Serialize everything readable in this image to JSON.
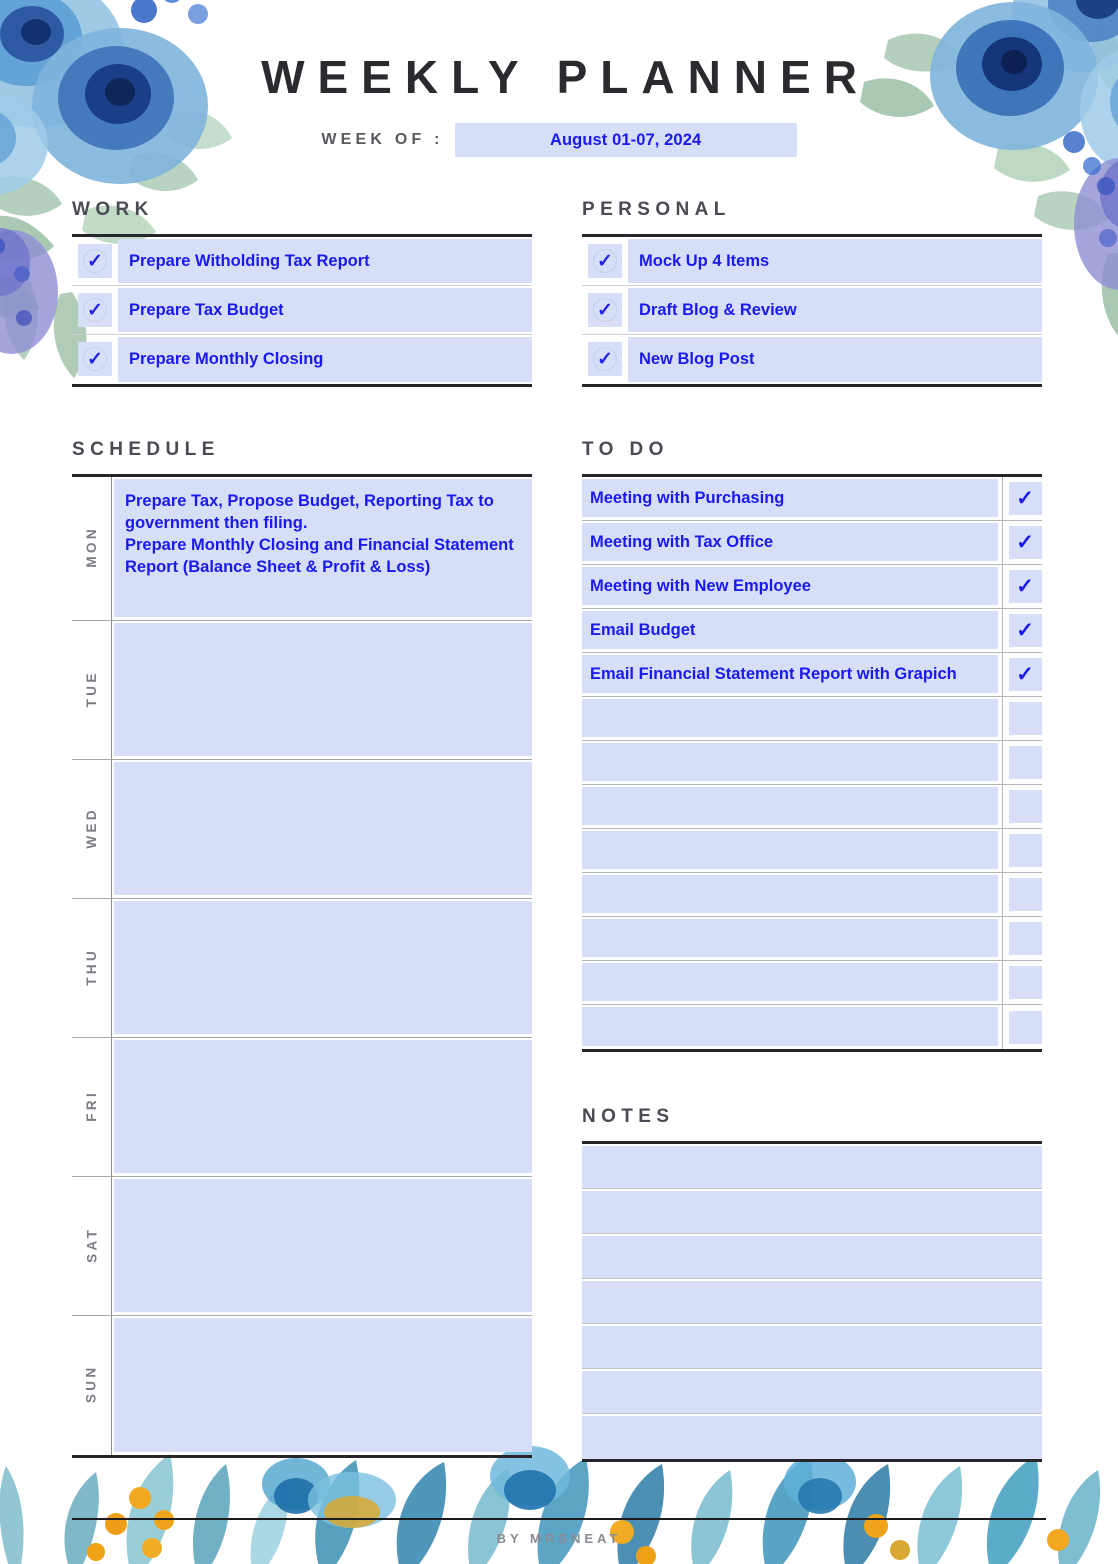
{
  "header": {
    "title": "WEEKLY PLANNER",
    "week_of_label": "WEEK OF :",
    "week_of_value": "August 01-07, 2024"
  },
  "colors": {
    "field_bg": "#d6deF8",
    "field_text": "#1a1aee",
    "heading": "#4b4b53",
    "rule": "#26262a",
    "day_label": "#7c7c85"
  },
  "work": {
    "title": "WORK",
    "items": [
      {
        "label": "Prepare Witholding Tax Report",
        "checked": true,
        "check_glyph": "✓"
      },
      {
        "label": "Prepare Tax Budget",
        "checked": true,
        "check_glyph": "✓"
      },
      {
        "label": "Prepare Monthly Closing",
        "checked": true,
        "check_glyph": "✓"
      }
    ]
  },
  "personal": {
    "title": "PERSONAL",
    "items": [
      {
        "label": "Mock Up 4 Items",
        "checked": true,
        "check_glyph": "✓"
      },
      {
        "label": "Draft Blog & Review",
        "checked": true,
        "check_glyph": "✓"
      },
      {
        "label": "New Blog Post",
        "checked": true,
        "check_glyph": "✓"
      }
    ]
  },
  "schedule": {
    "title": "SCHEDULE",
    "days": [
      {
        "day": "MON",
        "entry": "Prepare Tax, Propose Budget, Reporting Tax to government then filing.\nPrepare Monthly Closing and Financial Statement Report (Balance Sheet & Profit & Loss)"
      },
      {
        "day": "TUE",
        "entry": ""
      },
      {
        "day": "WED",
        "entry": ""
      },
      {
        "day": "THU",
        "entry": ""
      },
      {
        "day": "FRI",
        "entry": ""
      },
      {
        "day": "SAT",
        "entry": ""
      },
      {
        "day": "SUN",
        "entry": ""
      }
    ]
  },
  "todo": {
    "title": "TO DO",
    "items": [
      {
        "label": "Meeting with Purchasing",
        "checked": true,
        "check_glyph": "✓"
      },
      {
        "label": "Meeting with Tax Office",
        "checked": true,
        "check_glyph": "✓"
      },
      {
        "label": "Meeting with New Employee",
        "checked": true,
        "check_glyph": "✓"
      },
      {
        "label": "Email Budget",
        "checked": true,
        "check_glyph": "✓"
      },
      {
        "label": "Email Financial Statement Report with Grapich",
        "checked": true,
        "check_glyph": "✓"
      },
      {
        "label": "",
        "checked": false,
        "check_glyph": ""
      },
      {
        "label": "",
        "checked": false,
        "check_glyph": ""
      },
      {
        "label": "",
        "checked": false,
        "check_glyph": ""
      },
      {
        "label": "",
        "checked": false,
        "check_glyph": ""
      },
      {
        "label": "",
        "checked": false,
        "check_glyph": ""
      },
      {
        "label": "",
        "checked": false,
        "check_glyph": ""
      },
      {
        "label": "",
        "checked": false,
        "check_glyph": ""
      },
      {
        "label": "",
        "checked": false,
        "check_glyph": ""
      }
    ]
  },
  "notes": {
    "title": "NOTES",
    "lines": [
      "",
      "",
      "",
      "",
      "",
      "",
      ""
    ]
  },
  "footer": {
    "credit": "BY MRSNEAT"
  }
}
